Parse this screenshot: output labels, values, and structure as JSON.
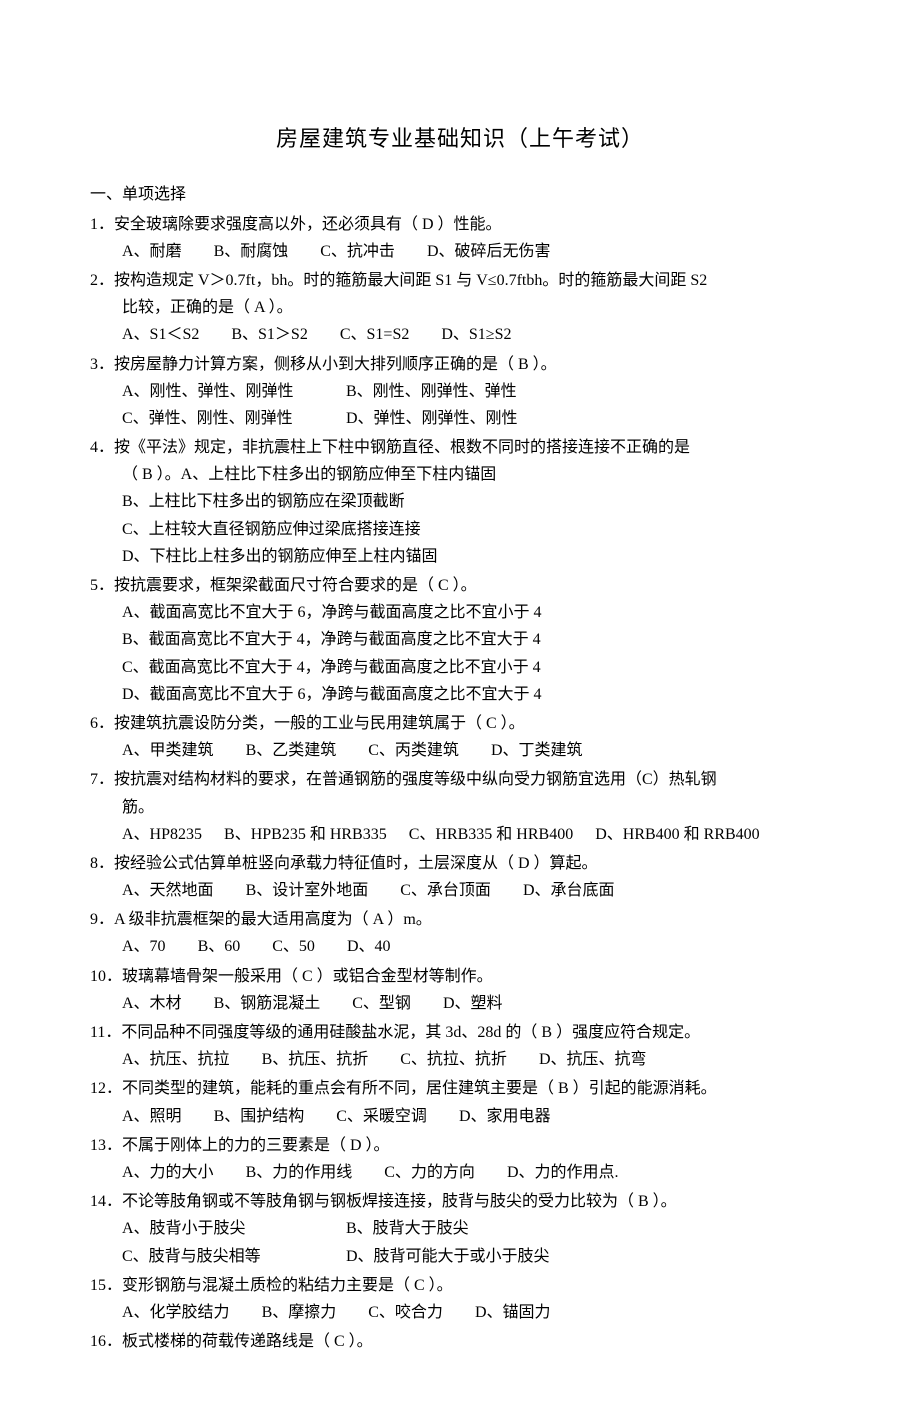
{
  "title": "房屋建筑专业基础知识（上午考试）",
  "section": "一、单项选择",
  "q1": {
    "text": "1．安全玻璃除要求强度高以外，还必须具有（ D ）性能。",
    "a": "A、耐磨",
    "b": "B、耐腐蚀",
    "c": "C、抗冲击",
    "d": "D、破碎后无伤害"
  },
  "q2": {
    "text": "2．按构造规定 V＞0.7ft，bh。时的箍筋最大间距 S1 与 V≤0.7ftbh。时的箍筋最大间距 S2",
    "cont": "比较，正确的是（ A ）。",
    "a": "A、S1＜S2",
    "b": "B、S1＞S2",
    "c": "C、S1=S2",
    "d": "D、S1≥S2"
  },
  "q3": {
    "text": "3．按房屋静力计算方案，侧移从小到大排列顺序正确的是（ B ）。",
    "a": "A、刚性、弹性、刚弹性",
    "b": "B、刚性、刚弹性、弹性",
    "c": "C、弹性、刚性、刚弹性",
    "d": "D、弹性、刚弹性、刚性"
  },
  "q4": {
    "text": "4．按《平法》规定，非抗震柱上下柱中钢筋直径、根数不同时的搭接连接不正确的是",
    "cont": "（ B ）。A、上柱比下柱多出的钢筋应伸至下柱内锚固",
    "b": "B、上柱比下柱多出的钢筋应在梁顶截断",
    "c": "C、上柱较大直径钢筋应伸过梁底搭接连接",
    "d": "D、下柱比上柱多出的钢筋应伸至上柱内锚固"
  },
  "q5": {
    "text": "5．按抗震要求，框架梁截面尺寸符合要求的是（ C ）。",
    "a": "A、截面高宽比不宜大于 6，净跨与截面高度之比不宜小于 4",
    "b": "B、截面高宽比不宜大于 4，净跨与截面高度之比不宜大于 4",
    "c": "C、截面高宽比不宜大于 4，净跨与截面高度之比不宜小于 4",
    "d": "D、截面高宽比不宜大于 6，净跨与截面高度之比不宜大于 4"
  },
  "q6": {
    "text": "6．按建筑抗震设防分类，一般的工业与民用建筑属于（ C ）。",
    "a": "A、甲类建筑",
    "b": "B、乙类建筑",
    "c": "C、丙类建筑",
    "d": "D、丁类建筑"
  },
  "q7": {
    "text": "7．按抗震对结构材料的要求，在普通钢筋的强度等级中纵向受力钢筋宜选用（C）热轧钢",
    "cont": "筋。",
    "a": "A、HP8235",
    "b": "B、HPB235 和 HRB335",
    "c": "C、HRB335 和 HRB400",
    "d": "D、HRB400 和 RRB400"
  },
  "q8": {
    "text": "8．按经验公式估算单桩竖向承载力特征值时，土层深度从（ D ）算起。",
    "a": "A、天然地面",
    "b": "B、设计室外地面",
    "c": "C、承台顶面",
    "d": "D、承台底面"
  },
  "q9": {
    "text": "9．A 级非抗震框架的最大适用高度为（ A ）m。",
    "a": "A、70",
    "b": "B、60",
    "c": "C、50",
    "d": "D、40"
  },
  "q10": {
    "text": "10．玻璃幕墙骨架一般采用（ C ）或铝合金型材等制作。",
    "a": "A、木材",
    "b": "B、钢筋混凝土",
    "c": "C、型钢",
    "d": "D、塑料"
  },
  "q11": {
    "text": "11．不同品种不同强度等级的通用硅酸盐水泥，其 3d、28d 的（ B ）强度应符合规定。",
    "a": "A、抗压、抗拉",
    "b": "B、抗压、抗折",
    "c": "C、抗拉、抗折",
    "d": "D、抗压、抗弯"
  },
  "q12": {
    "text": "12．不同类型的建筑，能耗的重点会有所不同，居住建筑主要是（ B ）引起的能源消耗。",
    "a": "A、照明",
    "b": "B、围护结构",
    "c": "C、采暖空调",
    "d": "D、家用电器"
  },
  "q13": {
    "text": "13．不属于刚体上的力的三要素是（ D ）。",
    "a": "A、力的大小",
    "b": "B、力的作用线",
    "c": "C、力的方向",
    "d": "D、力的作用点."
  },
  "q14": {
    "text": "14．不论等肢角钢或不等肢角钢与钢板焊接连接，肢背与肢尖的受力比较为（ B ）。",
    "a": "A、肢背小于肢尖",
    "b": "B、肢背大于肢尖",
    "c": "C、肢背与肢尖相等",
    "d": "D、肢背可能大于或小于肢尖"
  },
  "q15": {
    "text": "15．变形钢筋与混凝土质检的粘结力主要是（ C ）。",
    "a": "A、化学胶结力",
    "b": "B、摩擦力",
    "c": "C、咬合力",
    "d": "D、锚固力"
  },
  "q16": {
    "text": "16．板式楼梯的荷载传递路线是（ C ）。"
  }
}
